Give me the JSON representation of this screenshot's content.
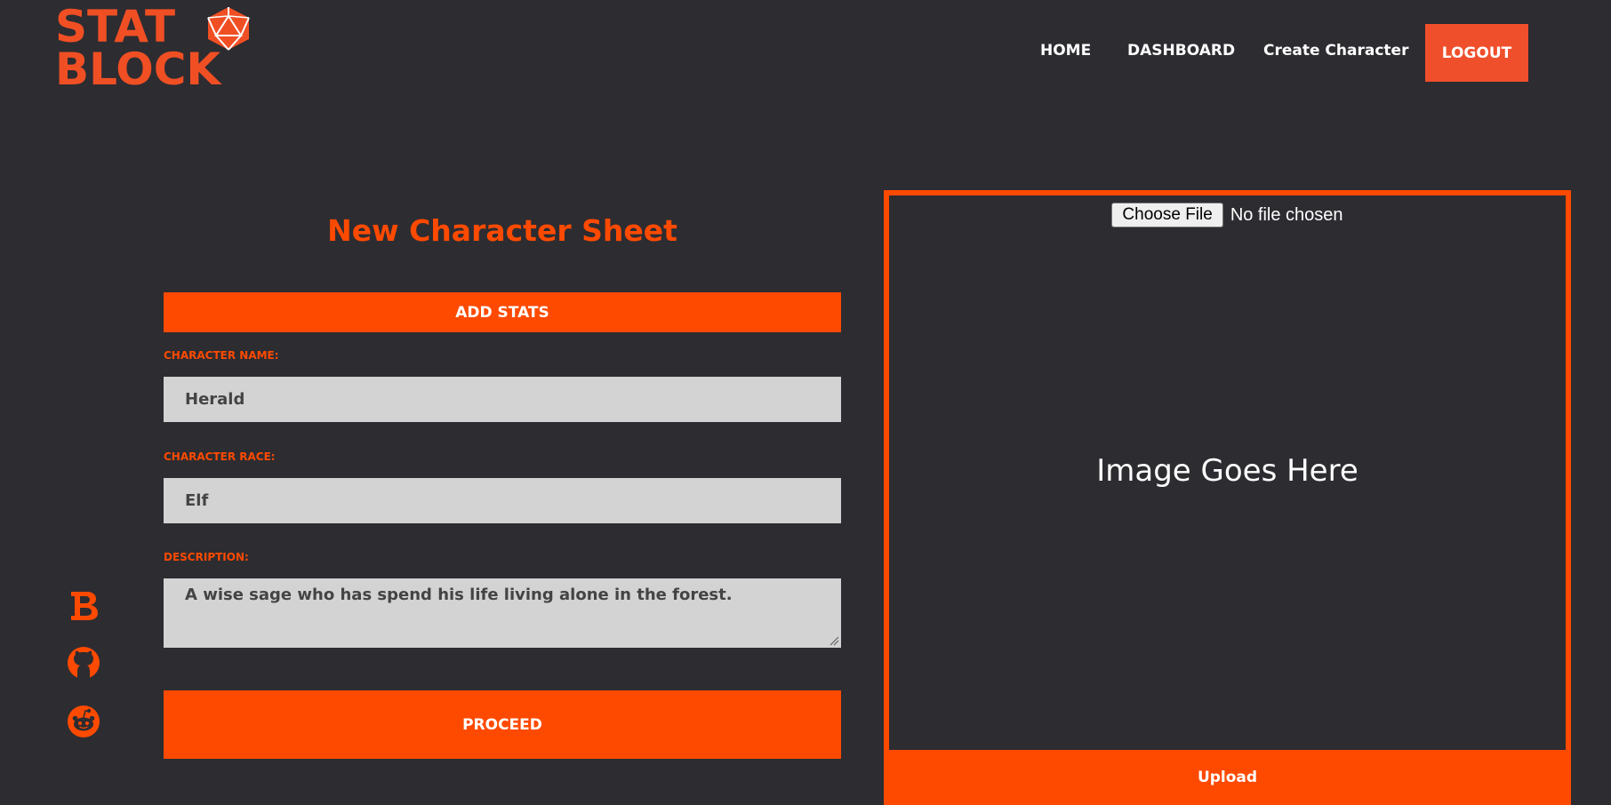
{
  "header": {
    "logo": {
      "line1": "STAT",
      "line2": "BLOCK",
      "icon": "d20-icon"
    },
    "nav": {
      "home": "HOME",
      "dashboard": "DASHBOARD",
      "create_character": "Create Character",
      "logout": "LOGOUT"
    }
  },
  "social": [
    {
      "icon": "bold-b-icon"
    },
    {
      "icon": "github-icon"
    },
    {
      "icon": "reddit-icon"
    }
  ],
  "form": {
    "title": "New Character Sheet",
    "add_stats": "ADD STATS",
    "name_label": "CHARACTER NAME:",
    "name_value": "Herald",
    "race_label": "CHARACTER RACE:",
    "race_value": "Elf",
    "description_label": "DESCRIPTION:",
    "description_value": "A wise sage who has spend his life living alone in the forest.",
    "proceed": "PROCEED"
  },
  "image_panel": {
    "choose_file": "Choose File",
    "no_file": "No file chosen",
    "placeholder": "Image Goes Here",
    "upload": "Upload"
  },
  "colors": {
    "background": "#2d2c31",
    "accent": "#fe4a00",
    "logo": "#f04f24",
    "input_bg": "#d3d3d3"
  }
}
